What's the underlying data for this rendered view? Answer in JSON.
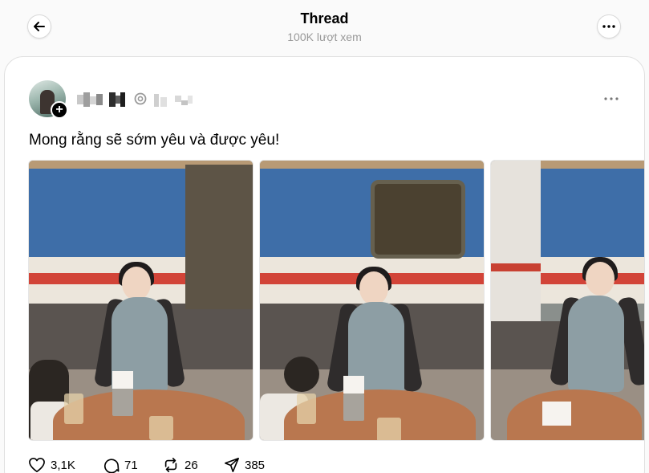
{
  "header": {
    "title": "Thread",
    "views": "100K lượt xem"
  },
  "post": {
    "text": "Mong rằng sẽ sớm yêu và được yêu!",
    "images": [
      "post-image-1",
      "post-image-2",
      "post-image-3"
    ]
  },
  "actions": {
    "likes": "3,1K",
    "comments": "71",
    "reposts": "26",
    "shares": "385"
  },
  "icons": {
    "back": "back-arrow-icon",
    "more": "more-icon",
    "verified": "verified-icon",
    "follow": "plus-icon",
    "like": "heart-icon",
    "comment": "comment-icon",
    "repost": "repost-icon",
    "share": "share-icon"
  }
}
